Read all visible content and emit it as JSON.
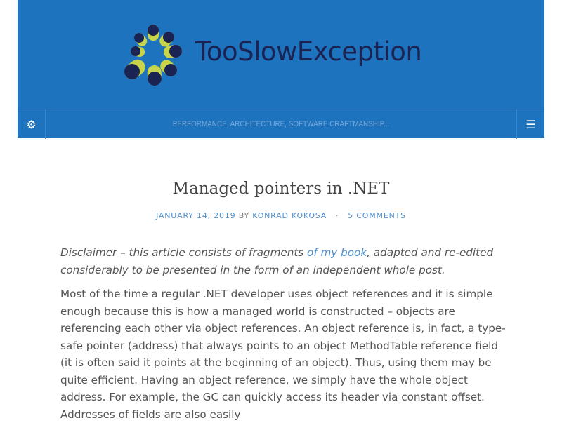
{
  "header": {
    "site_title": "TooSlowException",
    "tagline": "PERFORMANCE, ARCHITECTURE, SOFTWARE CRAFTMANSHIP...",
    "settings_icon": "gear-icon",
    "menu_icon": "hamburger-menu-icon"
  },
  "colors": {
    "brand_blue": "#1e73be",
    "logo_navy": "#1a2352",
    "logo_yellow": "#c8d44a",
    "link": "#4f8fcd"
  },
  "post": {
    "title": "Managed pointers in .NET",
    "date": "JANUARY 14, 2019",
    "by": "BY",
    "author": "KONRAD KOKOSA",
    "separator": "·",
    "comments": "5 COMMENTS",
    "disclaimer_before": "Disclaimer – this article consists of fragments ",
    "disclaimer_link": "of my book",
    "disclaimer_after": ", adapted and re-edited considerably to be presented in the form of an independent whole post.",
    "paragraph1": "Most of the time a regular .NET developer uses object references and it is simple enough because this is how a managed world is constructed – objects are referencing each other via object references. An object reference is, in fact, a type-safe pointer (address) that always points to an object MethodTable reference field (it is often said it points at the beginning of an object). Thus, using them may be quite efficient. Having an object reference, we simply have the whole object address. For example, the GC can quickly access its header via constant offset. Addresses of fields are also easily"
  }
}
